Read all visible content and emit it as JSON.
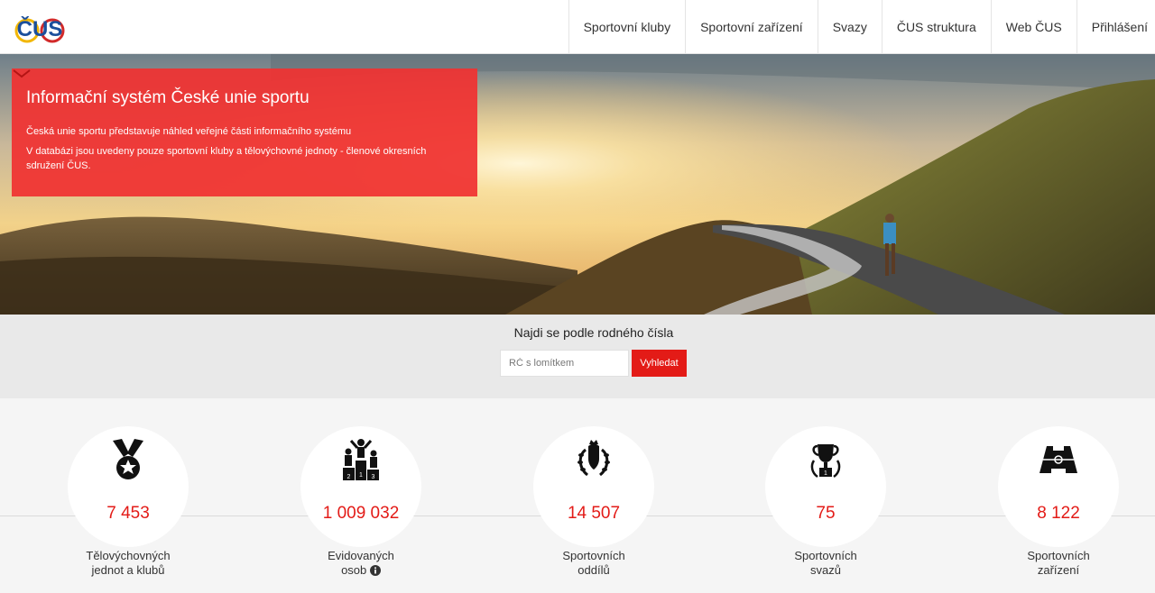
{
  "header": {
    "logo_text": "ČUS",
    "nav": [
      {
        "label": "Sportovní kluby"
      },
      {
        "label": "Sportovní zařízení"
      },
      {
        "label": "Svazy"
      },
      {
        "label": "ČUS struktura"
      },
      {
        "label": "Web ČUS"
      },
      {
        "label": "Přihlášení"
      }
    ]
  },
  "hero": {
    "title": "Informační systém České unie sportu",
    "paragraph1": "Česká unie sportu představuje náhled veřejné části informačního systému",
    "paragraph2": "V databázi jsou uvedeny pouze sportovní kluby a tělovýchovné jednoty - členové okresních sdružení ČUS."
  },
  "search": {
    "title": "Najdi se podle rodného čísla",
    "placeholder": "RČ s lomítkem",
    "button_label": "Vyhledat"
  },
  "stats": [
    {
      "value": "7 453",
      "label_line1": "Tělovýchovných",
      "label_line2": "jednot a klubů",
      "icon": "medal-icon"
    },
    {
      "value": "1 009 032",
      "label_line1": "Evidovaných",
      "label_line2": "osob",
      "icon": "podium-icon",
      "info_icon": "info-icon"
    },
    {
      "value": "14 507",
      "label_line1": "Sportovních",
      "label_line2": "oddílů",
      "icon": "laurel-crest-icon"
    },
    {
      "value": "75",
      "label_line1": "Sportovních",
      "label_line2": "svazů",
      "icon": "trophy-icon"
    },
    {
      "value": "8 122",
      "label_line1": "Sportovních",
      "label_line2": "zařízení",
      "icon": "stadium-icon"
    }
  ],
  "colors": {
    "accent": "#e31b17",
    "hero_box": "#f03232"
  }
}
